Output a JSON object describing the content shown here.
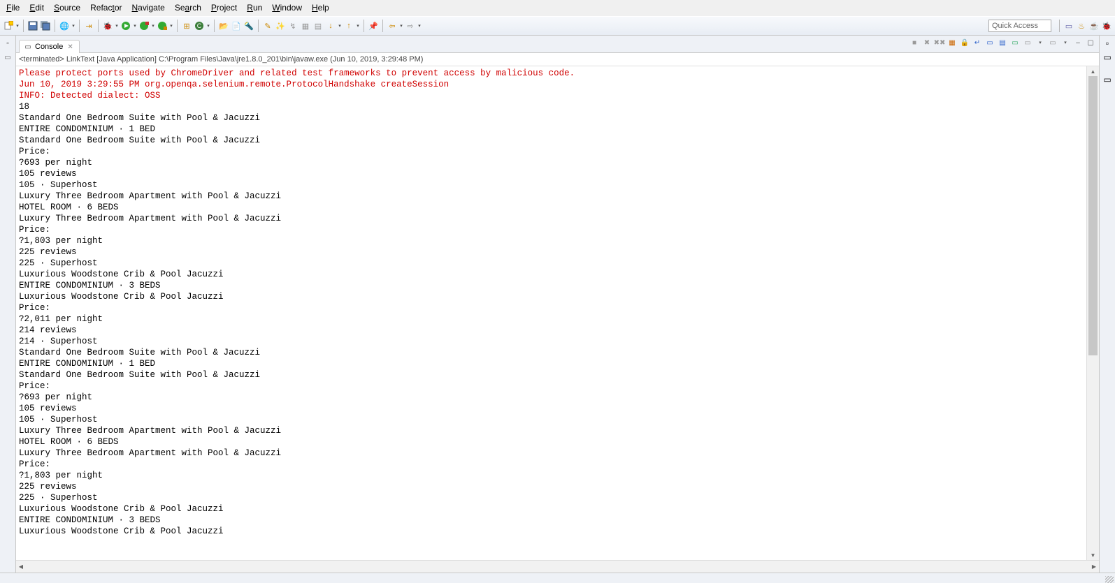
{
  "menu": {
    "file": "File",
    "edit": "Edit",
    "source": "Source",
    "refactor": "Refactor",
    "navigate": "Navigate",
    "search": "Search",
    "project": "Project",
    "run": "Run",
    "window": "Window",
    "help": "Help"
  },
  "toolbar": {
    "quick_access": "Quick Access"
  },
  "console": {
    "tab_label": "Console",
    "status": "<terminated> LinkText [Java Application] C:\\Program Files\\Java\\jre1.8.0_201\\bin\\javaw.exe (Jun 10, 2019, 3:29:48 PM)",
    "lines": [
      {
        "c": "red",
        "t": "Please protect ports used by ChromeDriver and related test frameworks to prevent access by malicious code."
      },
      {
        "c": "red",
        "t": "Jun 10, 2019 3:29:55 PM org.openqa.selenium.remote.ProtocolHandshake createSession"
      },
      {
        "c": "red",
        "t": "INFO: Detected dialect: OSS"
      },
      {
        "c": "blk",
        "t": "18"
      },
      {
        "c": "blk",
        "t": "Standard One Bedroom Suite with Pool & Jacuzzi"
      },
      {
        "c": "blk",
        "t": "ENTIRE CONDOMINIUM · 1 BED"
      },
      {
        "c": "blk",
        "t": "Standard One Bedroom Suite with Pool & Jacuzzi"
      },
      {
        "c": "blk",
        "t": "Price:"
      },
      {
        "c": "blk",
        "t": "?693 per night"
      },
      {
        "c": "blk",
        "t": "105 reviews"
      },
      {
        "c": "blk",
        "t": "105 · Superhost"
      },
      {
        "c": "blk",
        "t": "Luxury Three Bedroom Apartment with Pool & Jacuzzi"
      },
      {
        "c": "blk",
        "t": "HOTEL ROOM · 6 BEDS"
      },
      {
        "c": "blk",
        "t": "Luxury Three Bedroom Apartment with Pool & Jacuzzi"
      },
      {
        "c": "blk",
        "t": "Price:"
      },
      {
        "c": "blk",
        "t": "?1,803 per night"
      },
      {
        "c": "blk",
        "t": "225 reviews"
      },
      {
        "c": "blk",
        "t": "225 · Superhost"
      },
      {
        "c": "blk",
        "t": "Luxurious Woodstone Crib & Pool Jacuzzi"
      },
      {
        "c": "blk",
        "t": "ENTIRE CONDOMINIUM · 3 BEDS"
      },
      {
        "c": "blk",
        "t": "Luxurious Woodstone Crib & Pool Jacuzzi"
      },
      {
        "c": "blk",
        "t": "Price:"
      },
      {
        "c": "blk",
        "t": "?2,011 per night"
      },
      {
        "c": "blk",
        "t": "214 reviews"
      },
      {
        "c": "blk",
        "t": "214 · Superhost"
      },
      {
        "c": "blk",
        "t": "Standard One Bedroom Suite with Pool & Jacuzzi"
      },
      {
        "c": "blk",
        "t": "ENTIRE CONDOMINIUM · 1 BED"
      },
      {
        "c": "blk",
        "t": "Standard One Bedroom Suite with Pool & Jacuzzi"
      },
      {
        "c": "blk",
        "t": "Price:"
      },
      {
        "c": "blk",
        "t": "?693 per night"
      },
      {
        "c": "blk",
        "t": "105 reviews"
      },
      {
        "c": "blk",
        "t": "105 · Superhost"
      },
      {
        "c": "blk",
        "t": "Luxury Three Bedroom Apartment with Pool & Jacuzzi"
      },
      {
        "c": "blk",
        "t": "HOTEL ROOM · 6 BEDS"
      },
      {
        "c": "blk",
        "t": "Luxury Three Bedroom Apartment with Pool & Jacuzzi"
      },
      {
        "c": "blk",
        "t": "Price:"
      },
      {
        "c": "blk",
        "t": "?1,803 per night"
      },
      {
        "c": "blk",
        "t": "225 reviews"
      },
      {
        "c": "blk",
        "t": "225 · Superhost"
      },
      {
        "c": "blk",
        "t": "Luxurious Woodstone Crib & Pool Jacuzzi"
      },
      {
        "c": "blk",
        "t": "ENTIRE CONDOMINIUM · 3 BEDS"
      },
      {
        "c": "blk",
        "t": "Luxurious Woodstone Crib & Pool Jacuzzi"
      }
    ]
  }
}
